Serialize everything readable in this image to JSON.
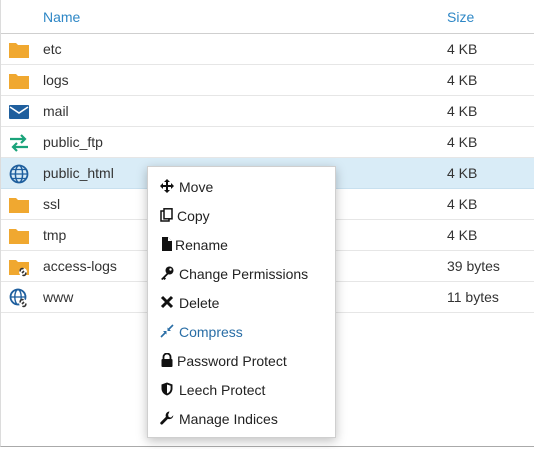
{
  "table": {
    "headers": {
      "name": "Name",
      "size": "Size"
    },
    "rows": [
      {
        "name": "etc",
        "size": "4 KB",
        "icon": "folder-icon"
      },
      {
        "name": "logs",
        "size": "4 KB",
        "icon": "folder-icon"
      },
      {
        "name": "mail",
        "size": "4 KB",
        "icon": "mail-icon"
      },
      {
        "name": "public_ftp",
        "size": "4 KB",
        "icon": "transfer-arrows-icon"
      },
      {
        "name": "public_html",
        "size": "4 KB",
        "icon": "globe-icon",
        "selected": true
      },
      {
        "name": "ssl",
        "size": "4 KB",
        "icon": "folder-icon"
      },
      {
        "name": "tmp",
        "size": "4 KB",
        "icon": "folder-icon"
      },
      {
        "name": "access-logs",
        "size": "39 bytes",
        "icon": "folder-link-icon"
      },
      {
        "name": "www",
        "size": "11 bytes",
        "icon": "globe-link-icon"
      }
    ]
  },
  "context_menu": {
    "items": [
      {
        "label": "Move",
        "icon": "move-icon"
      },
      {
        "label": "Copy",
        "icon": "copy-icon"
      },
      {
        "label": "Rename",
        "icon": "file-icon"
      },
      {
        "label": "Change Permissions",
        "icon": "key-icon"
      },
      {
        "label": "Delete",
        "icon": "x-icon"
      },
      {
        "label": "Compress",
        "icon": "compress-icon"
      },
      {
        "label": "Password Protect",
        "icon": "lock-icon"
      },
      {
        "label": "Leech Protect",
        "icon": "shield-icon"
      },
      {
        "label": "Manage Indices",
        "icon": "wrench-icon"
      }
    ]
  },
  "colors": {
    "accent": "#2e87c6",
    "folder": "#f0a830",
    "mail": "#1f5f9e",
    "ftp": "#1aa37a",
    "selected_row": "#d9ecf7"
  }
}
